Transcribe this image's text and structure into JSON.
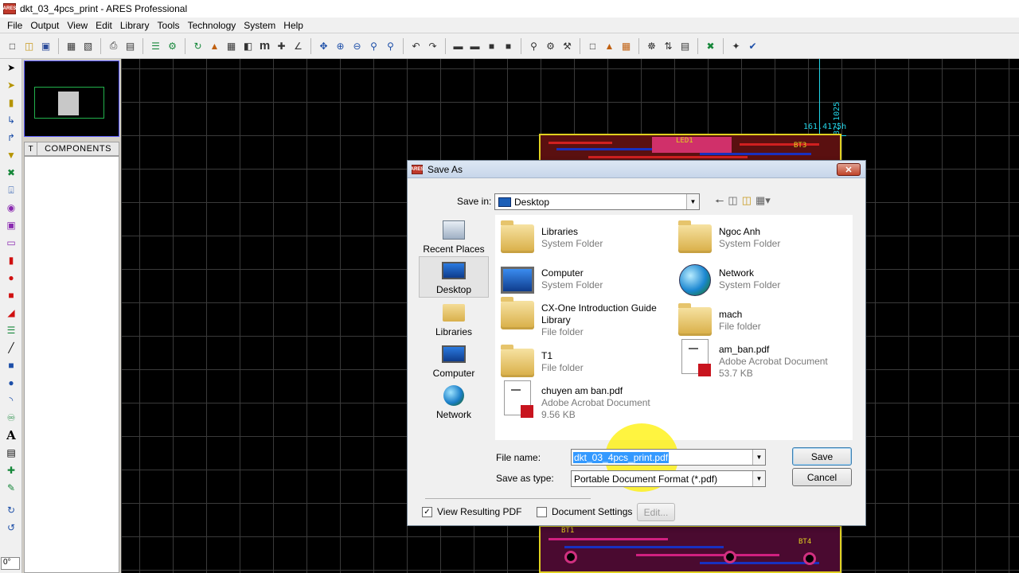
{
  "window": {
    "title": "dkt_03_4pcs_print - ARES Professional",
    "app_icon": "ARES"
  },
  "menu": [
    "File",
    "Output",
    "View",
    "Edit",
    "Library",
    "Tools",
    "Technology",
    "System",
    "Help"
  ],
  "left_panel": {
    "tab_letter": "T",
    "components_header": "COMPONENTS",
    "angle_value": "0°"
  },
  "canvas": {
    "dimension_label": "161.4175h",
    "dimension_vertical": "82.1025",
    "labels": {
      "led1": "LED1",
      "bt3": "BT3",
      "bt1": "BT1",
      "bt4": "BT4"
    }
  },
  "dialog": {
    "title": "Save As",
    "save_in_label": "Save in:",
    "save_in_value": "Desktop",
    "places": [
      "Recent Places",
      "Desktop",
      "Libraries",
      "Computer",
      "Network"
    ],
    "files": [
      {
        "name": "Libraries",
        "sub": "System Folder",
        "size": "",
        "icon": "libraries-folder-icon"
      },
      {
        "name": "Ngoc Anh",
        "sub": "System Folder",
        "size": "",
        "icon": "user-folder-icon"
      },
      {
        "name": "Computer",
        "sub": "System Folder",
        "size": "",
        "icon": "computer-icon"
      },
      {
        "name": "Network",
        "sub": "System Folder",
        "size": "",
        "icon": "network-icon"
      },
      {
        "name": "CX-One Introduction Guide Library",
        "sub": "File folder",
        "size": "",
        "icon": "folder-icon"
      },
      {
        "name": "mach",
        "sub": "File folder",
        "size": "",
        "icon": "folder-icon"
      },
      {
        "name": "T1",
        "sub": "File folder",
        "size": "",
        "icon": "folder-icon"
      },
      {
        "name": "am_ban.pdf",
        "sub": "Adobe Acrobat Document",
        "size": "53.7 KB",
        "icon": "pdf-icon"
      },
      {
        "name": "chuyen am ban.pdf",
        "sub": "Adobe Acrobat Document",
        "size": "9.56 KB",
        "icon": "pdf-icon"
      }
    ],
    "file_name_label": "File name:",
    "file_name_value": "dkt_03_4pcs_print.pdf",
    "save_type_label": "Save as type:",
    "save_type_value": "Portable Document Format (*.pdf)",
    "save_button": "Save",
    "cancel_button": "Cancel",
    "view_pdf_label": "View Resulting PDF",
    "view_pdf_checked": true,
    "doc_settings_label": "Document Settings",
    "doc_settings_checked": false,
    "edit_button": "Edit..."
  }
}
